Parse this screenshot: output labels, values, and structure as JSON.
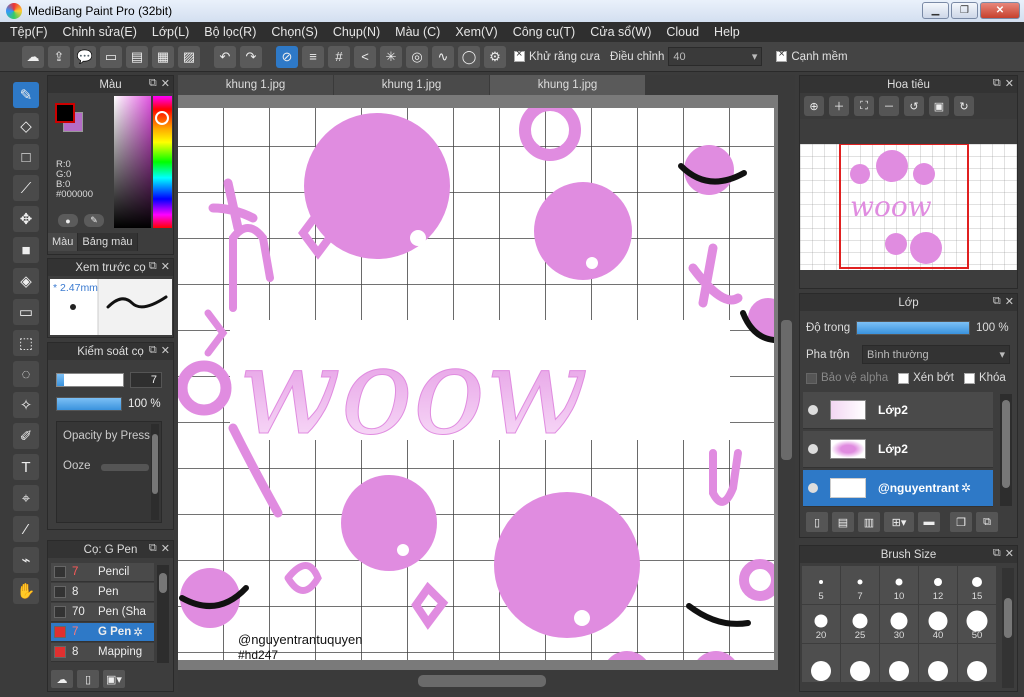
{
  "window": {
    "title": "MediBang Paint Pro (32bit)"
  },
  "menu": [
    "Tệp(F)",
    "Chỉnh sửa(E)",
    "Lớp(L)",
    "Bộ lọc(R)",
    "Chọn(S)",
    "Chụp(N)",
    "Màu (C)",
    "Xem(V)",
    "Công cụ(T)",
    "Cửa sổ(W)",
    "Cloud",
    "Help"
  ],
  "toolbar": {
    "antialias_label": "Khử răng cưa",
    "adjust_label": "Điều chỉnh",
    "adjust_value": "40",
    "soft_edge_label": "Cạnh mềm"
  },
  "color_panel": {
    "title": "Màu",
    "r": "R:0",
    "g": "G:0",
    "b": "B:0",
    "hex": "#000000",
    "tab_color": "Màu",
    "tab_palette": "Bảng màu",
    "foreground": "#000000",
    "background": "#b46cc6"
  },
  "brush_preview": {
    "title": "Xem trước cọ",
    "size": "* 2.47mm"
  },
  "brush_control": {
    "title": "Kiểm soát cọ",
    "size_value": "7",
    "opacity_value": "100 %",
    "opacity_fraction": 1.0,
    "size_fraction": 0.1,
    "opacity_by_pressure": "Opacity by Press",
    "ooze": "Ooze"
  },
  "brush_list": {
    "title": "Cọ: G Pen",
    "items": [
      {
        "num": "7",
        "name": "Pencil",
        "num_color": "#ff5a5a",
        "swatch": "#333333"
      },
      {
        "num": "8",
        "name": "Pen",
        "num_color": "#eeeeee",
        "swatch": "#333333"
      },
      {
        "num": "70",
        "name": "Pen (Sha",
        "num_color": "#eeeeee",
        "swatch": "#333333"
      },
      {
        "num": "7",
        "name": "G Pen",
        "num_color": "#ff7a7a",
        "swatch": "#e03030"
      },
      {
        "num": "8",
        "name": "Mapping",
        "num_color": "#eeeeee",
        "swatch": "#e03030"
      }
    ]
  },
  "tabs": [
    "khung 1.jpg",
    "khung 1.jpg",
    "khung 1.jpg"
  ],
  "canvas": {
    "watermark_line1": "@nguyentrantuquyen",
    "watermark_line2": "#hd247",
    "art_text": "woow",
    "accent": "#e08ce0"
  },
  "navigator": {
    "title": "Hoa tiêu"
  },
  "layers": {
    "title": "Lớp",
    "opacity_label": "Độ trong",
    "opacity_value": "100 %",
    "opacity_fraction": 1.0,
    "blend_label": "Pha trộn",
    "blend_value": "Bình thường",
    "protect_alpha": "Bảo vệ alpha",
    "clipping": "Xén bớt",
    "lock": "Khóa",
    "items": [
      {
        "name": "Lớp2",
        "active": false
      },
      {
        "name": "Lớp2",
        "active": false
      },
      {
        "name": "@nguyentrant",
        "active": true
      }
    ]
  },
  "brush_size": {
    "title": "Brush Size",
    "sizes": [
      "5",
      "7",
      "10",
      "12",
      "15",
      "20",
      "25",
      "30",
      "40",
      "50",
      "",
      "",
      "",
      "",
      ""
    ]
  }
}
